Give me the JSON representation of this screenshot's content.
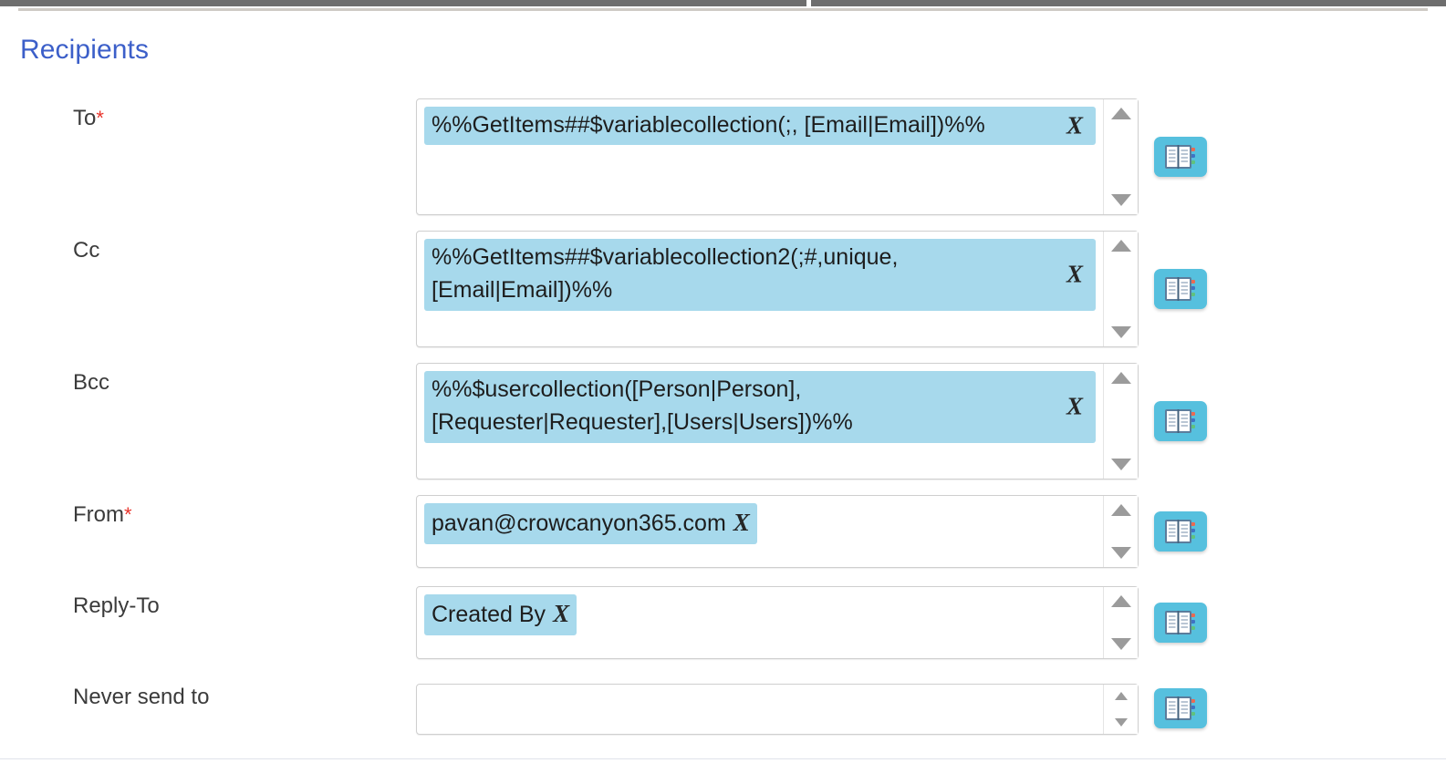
{
  "section": {
    "title": "Recipients"
  },
  "fields": [
    {
      "label": "To",
      "required": true,
      "required_mark": "*",
      "value": "%%GetItems##$variablecollection(;, [Email|Email])%%",
      "remove_label": "X",
      "multiline": true,
      "picker_icon": "address-book-icon",
      "picker_title": "Select recipients"
    },
    {
      "label": "Cc",
      "required": false,
      "required_mark": "",
      "value": "%%GetItems##$variablecollection2(;#,unique, [Email|Email])%%",
      "remove_label": "X",
      "multiline": true,
      "picker_icon": "address-book-icon",
      "picker_title": "Select recipients"
    },
    {
      "label": "Bcc",
      "required": false,
      "required_mark": "",
      "value": "%%$usercollection([Person|Person], [Requester|Requester],[Users|Users])%%",
      "remove_label": "X",
      "multiline": true,
      "picker_icon": "address-book-icon",
      "picker_title": "Select recipients"
    },
    {
      "label": "From",
      "required": true,
      "required_mark": "*",
      "value": "pavan@crowcanyon365.com",
      "remove_label": "X",
      "multiline": false,
      "picker_icon": "address-book-icon",
      "picker_title": "Select sender"
    },
    {
      "label": "Reply-To",
      "required": false,
      "required_mark": "",
      "value": "Created By",
      "remove_label": "X",
      "multiline": false,
      "picker_icon": "address-book-icon",
      "picker_title": "Select reply-to"
    },
    {
      "label": "Never send to",
      "required": false,
      "required_mark": "",
      "value": "",
      "remove_label": "",
      "multiline": false,
      "picker_icon": "address-book-icon",
      "picker_title": "Select recipients"
    }
  ],
  "colors": {
    "heading": "#3c5fc9",
    "chip_background": "#a7d9ec",
    "picker_button": "#56c0de",
    "required_asterisk": "#e8342b",
    "field_border": "#cfcfcf",
    "top_bar": "#6e6e6e"
  },
  "scrollbar": {
    "up_icon": "triangle-up-icon",
    "down_icon": "triangle-down-icon"
  }
}
